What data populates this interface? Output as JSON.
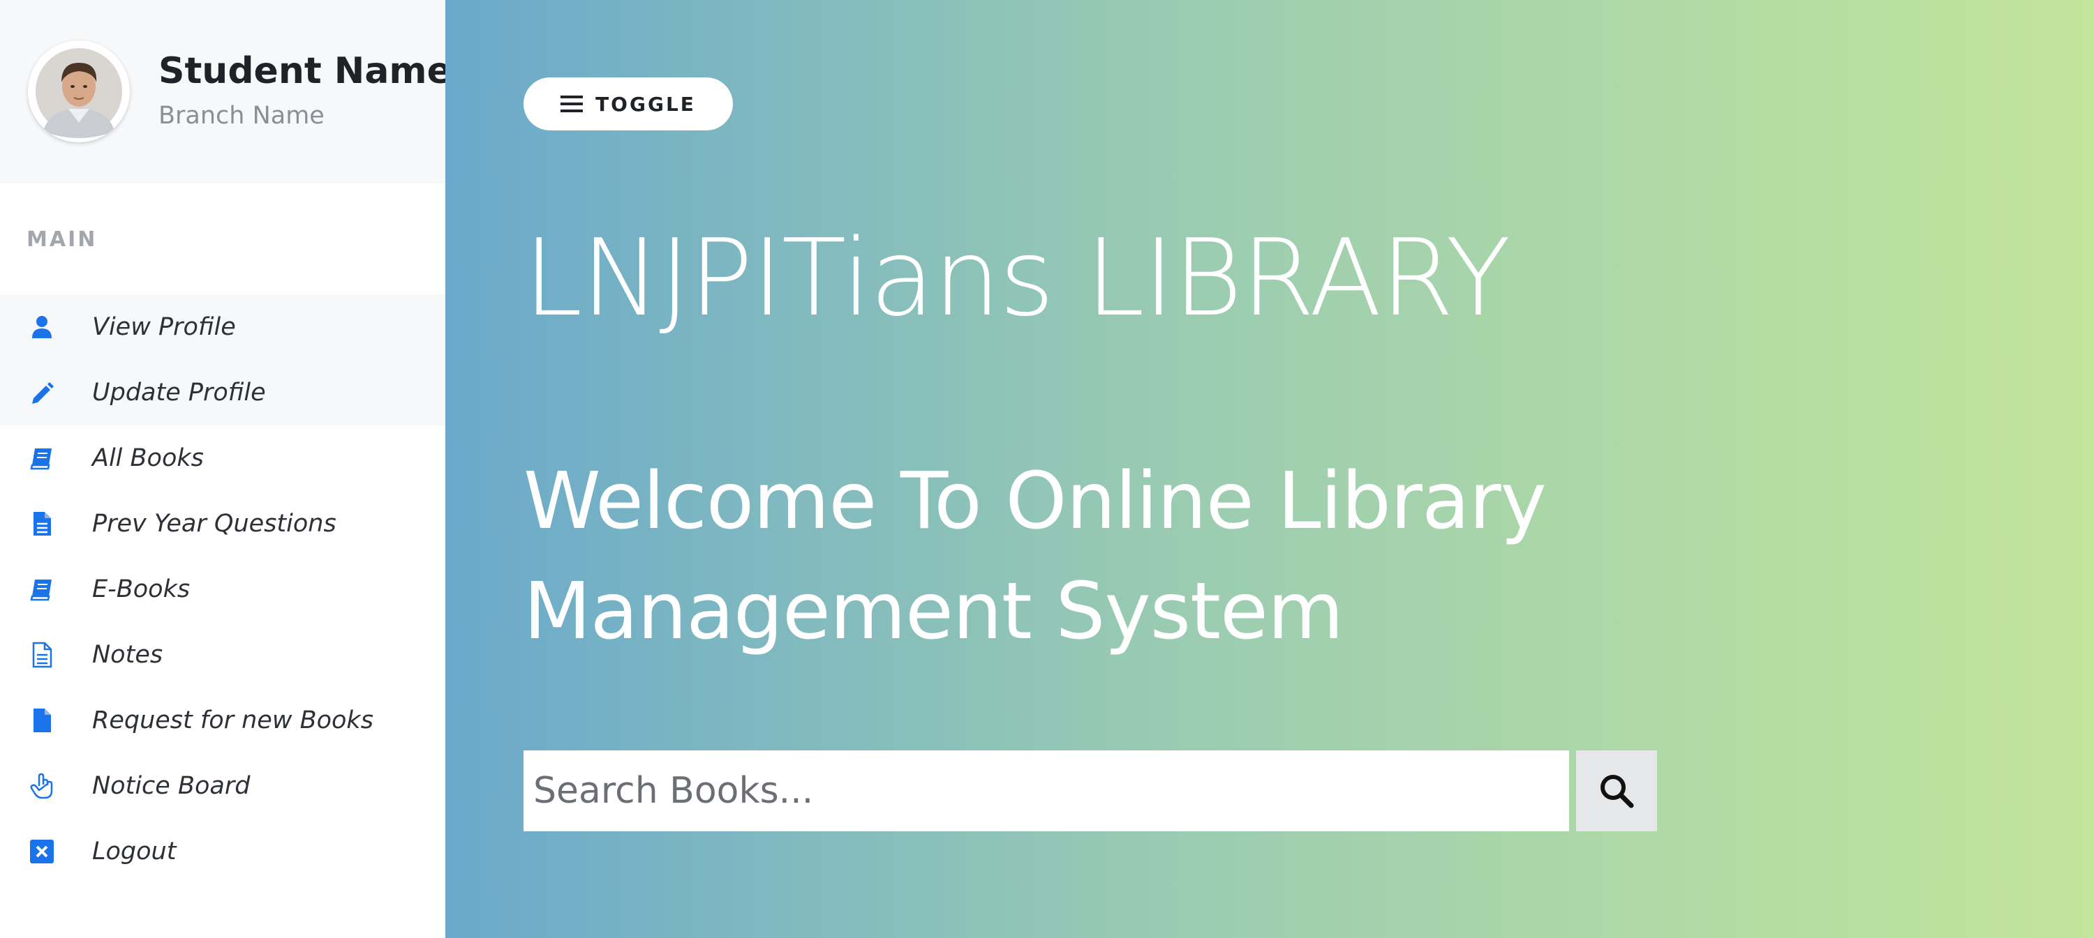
{
  "sidebar": {
    "profile": {
      "name": "Student Name",
      "branch": "Branch Name",
      "avatar_icon": "student-avatar"
    },
    "section_label": "MAIN",
    "items": [
      {
        "label": "View Profile",
        "icon": "user-icon",
        "active": true
      },
      {
        "label": "Update Profile",
        "icon": "pencil-icon",
        "active": true
      },
      {
        "label": "All Books",
        "icon": "book-icon",
        "active": false
      },
      {
        "label": "Prev Year Questions",
        "icon": "file-text-icon",
        "active": false
      },
      {
        "label": "E-Books",
        "icon": "book-icon",
        "active": false
      },
      {
        "label": "Notes",
        "icon": "file-outline-icon",
        "active": false
      },
      {
        "label": "Request for new Books",
        "icon": "file-icon",
        "active": false
      },
      {
        "label": "Notice Board",
        "icon": "hand-icon",
        "active": false
      },
      {
        "label": "Logout",
        "icon": "close-square-icon",
        "active": false
      }
    ]
  },
  "main": {
    "toggle_label": "TOGGLE",
    "title": "LNJPITians LIBRARY",
    "welcome_line1": "Welcome To Online Library",
    "welcome_line2": "Management System",
    "search": {
      "placeholder": "Search Books...",
      "value": ""
    }
  },
  "colors": {
    "accent_blue": "#1a73e8",
    "gradient_start": "#6aa9cb",
    "gradient_end": "#c2e59b",
    "sidebar_active_bg": "#f7f8fa"
  }
}
